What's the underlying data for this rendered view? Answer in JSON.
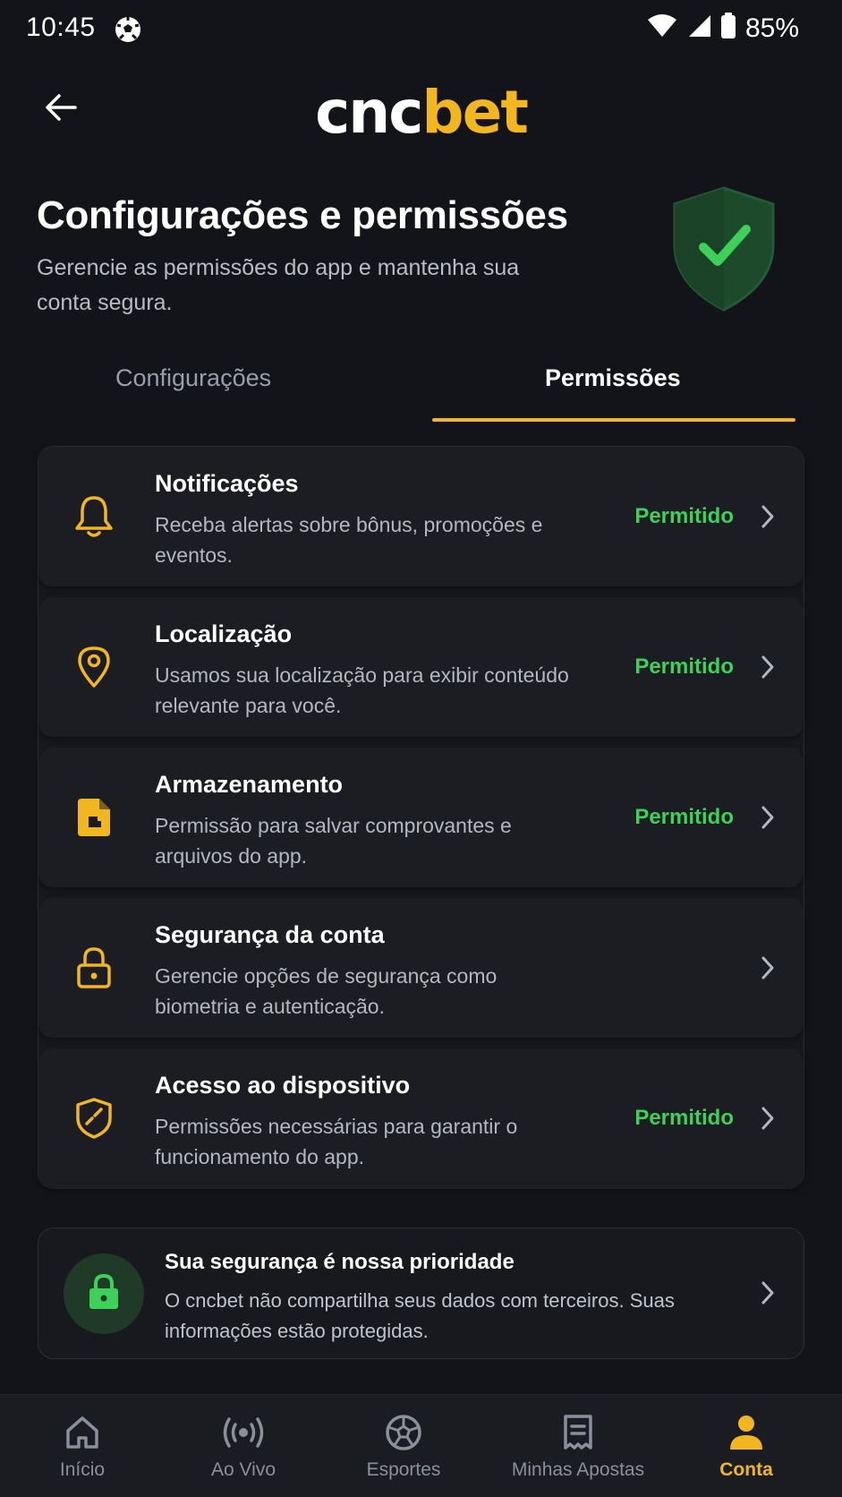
{
  "status_bar": {
    "time": "10:45",
    "battery": "85%",
    "icons": [
      "soccer-ball-icon",
      "wifi-icon",
      "signal-icon",
      "battery-icon"
    ]
  },
  "header": {
    "logo_part1": "cnc",
    "logo_part2": "bet",
    "back_icon": "arrow-left-icon"
  },
  "page": {
    "title": "Configurações e permissões",
    "subtitle": "Gerencie as permissões do app e mantenha sua conta segura."
  },
  "tabs": [
    {
      "label": "Configurações",
      "active": false
    },
    {
      "label": "Permissões",
      "active": true
    }
  ],
  "permissions": [
    {
      "icon": "bell-icon",
      "title": "Notificações",
      "description": "Receba alertas sobre bônus, promoções e eventos.",
      "status": "Permitido"
    },
    {
      "icon": "location-pin-icon",
      "title": "Localização",
      "description": "Usamos sua localização para exibir conteúdo relevante para você.",
      "status": "Permitido"
    },
    {
      "icon": "file-icon",
      "title": "Armazenamento",
      "description": "Permissão para salvar comprovantes e arquivos do app.",
      "status": "Permitido"
    },
    {
      "icon": "lock-icon",
      "title": "Segurança da conta",
      "description": "Gerencie opções de segurança como biometria e autenticação.",
      "status": ""
    },
    {
      "icon": "shield-check-icon",
      "title": "Acesso ao dispositivo",
      "description": "Permissões necessárias para garantir o funcionamento do app.",
      "status": "Permitido"
    }
  ],
  "security_card": {
    "title": "Sua segurança é nossa prioridade",
    "description": "O cncbet não compartilha seus dados com terceiros. Suas informações estão protegidas.",
    "icon": "lock-icon"
  },
  "bottom_nav": [
    {
      "label": "Início",
      "icon": "home-icon",
      "active": false
    },
    {
      "label": "Ao Vivo",
      "icon": "live-broadcast-icon",
      "active": false
    },
    {
      "label": "Esportes",
      "icon": "soccer-ball-icon",
      "active": false
    },
    {
      "label": "Minhas Apostas",
      "icon": "receipt-icon",
      "active": false
    },
    {
      "label": "Conta",
      "icon": "user-icon",
      "active": true
    }
  ],
  "colors": {
    "background": "#121419",
    "accent": "#f2b61f",
    "success": "#3ed15a",
    "card": "#1b1d23"
  }
}
